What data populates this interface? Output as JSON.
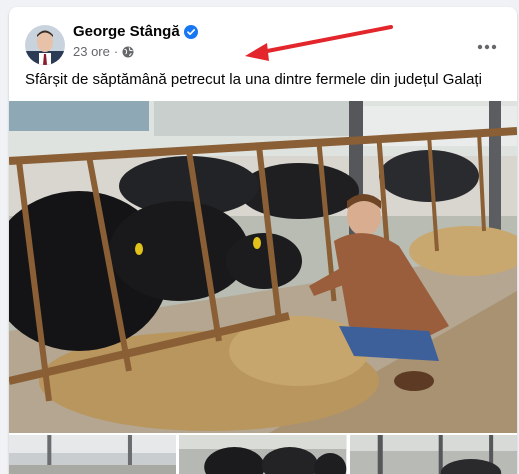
{
  "post": {
    "author": "George Stângă",
    "time": "23 ore",
    "separator": "·",
    "caption": "Sfârșit de săptămână petrecut la una dintre fermele din județul Galați",
    "icons": {
      "verified": "verified-badge-icon",
      "privacy": "globe-icon",
      "more": "more-options-icon"
    }
  },
  "colors": {
    "verified": "#1877f2",
    "arrow": "#e3262b",
    "secondary_text": "#65676b"
  }
}
